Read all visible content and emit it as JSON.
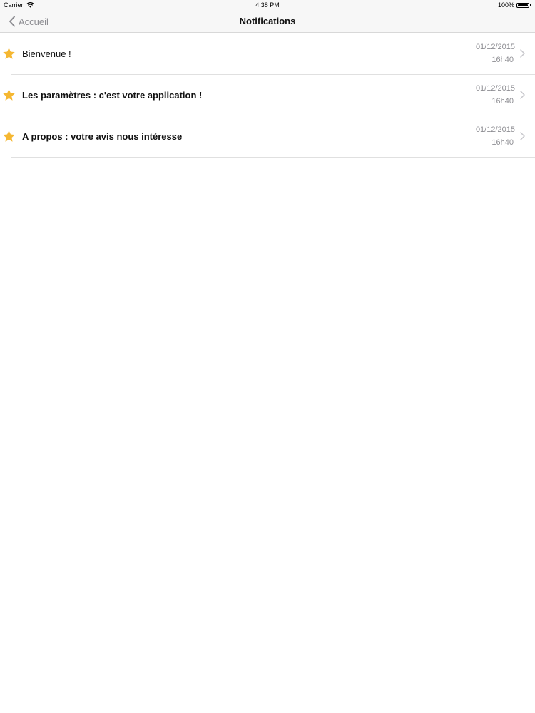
{
  "status_bar": {
    "carrier": "Carrier",
    "time": "4:38 PM",
    "battery": "100%",
    "battery_level": 1.0
  },
  "nav_bar": {
    "back_label": "Accueil",
    "title": "Notifications"
  },
  "notifications": [
    {
      "title": "Bienvenue !",
      "date": "01/12/2015",
      "time": "16h40",
      "bold": false
    },
    {
      "title": "Les paramètres : c'est votre application !",
      "date": "01/12/2015",
      "time": "16h40",
      "bold": true
    },
    {
      "title": "A propos : votre avis nous intéresse",
      "date": "01/12/2015",
      "time": "16h40",
      "bold": true
    }
  ],
  "colors": {
    "star": "#F5B731",
    "secondary_text": "#8E8E93",
    "bar_background": "#F7F7F7",
    "separator": "#E0E0E0"
  },
  "icons": {
    "wifi": "wifi-icon",
    "battery": "battery-icon",
    "back": "chevron-left-icon",
    "favorite": "star-icon",
    "disclosure": "chevron-right-icon"
  }
}
